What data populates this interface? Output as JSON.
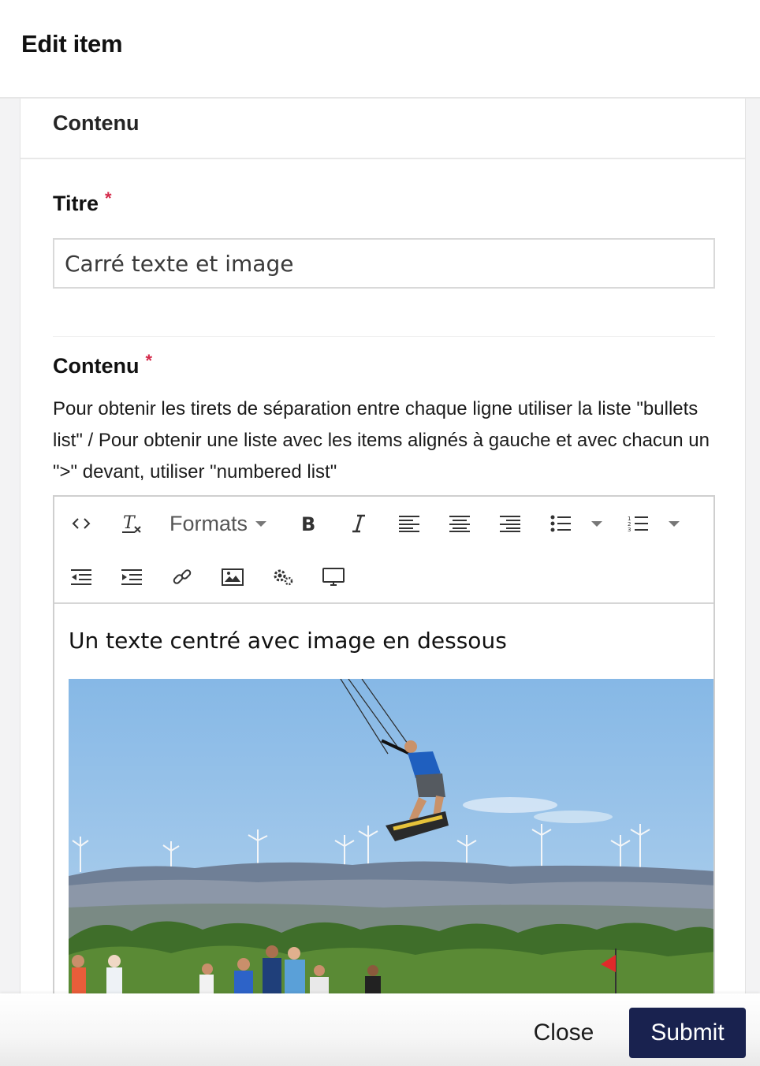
{
  "modal": {
    "title": "Edit item"
  },
  "panel": {
    "heading": "Contenu"
  },
  "fields": {
    "title": {
      "label": "Titre",
      "required_mark": "*",
      "value": "Carré texte et image"
    },
    "content": {
      "label": "Contenu",
      "required_mark": "*",
      "help_text": "Pour obtenir les tirets de séparation entre chaque ligne utiliser la liste \"bullets list\" / Pour obtenir une liste avec les items alignés à gauche et avec chacun un \">\" devant, utiliser \"numbered list\""
    }
  },
  "editor": {
    "toolbar": {
      "formats_label": "Formats",
      "icons": [
        "source-code-icon",
        "clear-formatting-icon",
        "bold-icon",
        "italic-icon",
        "align-left-icon",
        "align-center-icon",
        "align-right-icon",
        "bullet-list-icon",
        "numbered-list-icon",
        "outdent-icon",
        "indent-icon",
        "link-icon",
        "image-icon",
        "settings-icon",
        "preview-icon"
      ]
    },
    "content_text": "Un texte centré avec image en dessous",
    "image_subject": "kitesurfer-photo"
  },
  "footer": {
    "close_label": "Close",
    "submit_label": "Submit"
  },
  "colors": {
    "submit_bg": "#19224f",
    "required": "#d42a4a",
    "sky": "#8fbde6"
  }
}
